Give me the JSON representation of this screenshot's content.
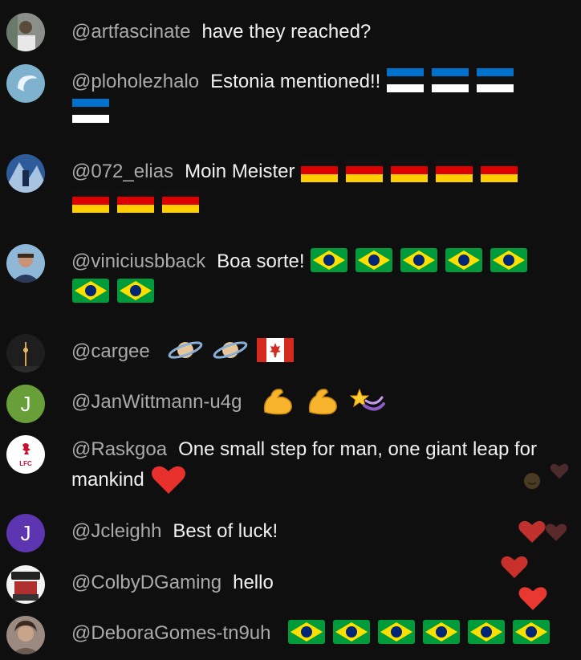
{
  "messages": [
    {
      "author": "@artfascinate",
      "text": "have they reached?",
      "emojis": []
    },
    {
      "author": "@ploholezhalo",
      "text": "Estonia mentioned!!",
      "emojis": [
        "flag-ee",
        "flag-ee",
        "flag-ee",
        "flag-ee"
      ]
    },
    {
      "author": "@072_elias",
      "text": "Moin Meister",
      "emojis": [
        "flag-de",
        "flag-de",
        "flag-de",
        "flag-de",
        "flag-de",
        "flag-de",
        "flag-de",
        "flag-de"
      ]
    },
    {
      "author": "@viniciusbback",
      "text": "Boa sorte!",
      "emojis": [
        "flag-br",
        "flag-br",
        "flag-br",
        "flag-br",
        "flag-br",
        "flag-br",
        "flag-br"
      ]
    },
    {
      "author": "@cargee",
      "text": "",
      "emojis": [
        "ringed-planet",
        "ringed-planet",
        "flag-ca"
      ]
    },
    {
      "author": "@JanWittmann-u4g",
      "avatar_letter": "J",
      "text": "",
      "emojis": [
        "flexed-biceps",
        "flexed-biceps",
        "dizzy"
      ]
    },
    {
      "author": "@Raskgoa",
      "text": "One small step for man, one giant leap for mankind",
      "emojis": [
        "red-heart"
      ]
    },
    {
      "author": "@Jcleighh",
      "avatar_letter": "J",
      "text": "Best of luck!",
      "emojis": []
    },
    {
      "author": "@ColbyDGaming",
      "text": "hello",
      "emojis": []
    },
    {
      "author": "@DeboraGomes-tn9uh",
      "text": "",
      "emojis": [
        "flag-br",
        "flag-br",
        "flag-br",
        "flag-br",
        "flag-br",
        "flag-br"
      ]
    }
  ],
  "avatar_colors": {
    "JanWittmann": "#689f38",
    "Jcleighh": "#5e35b1"
  }
}
